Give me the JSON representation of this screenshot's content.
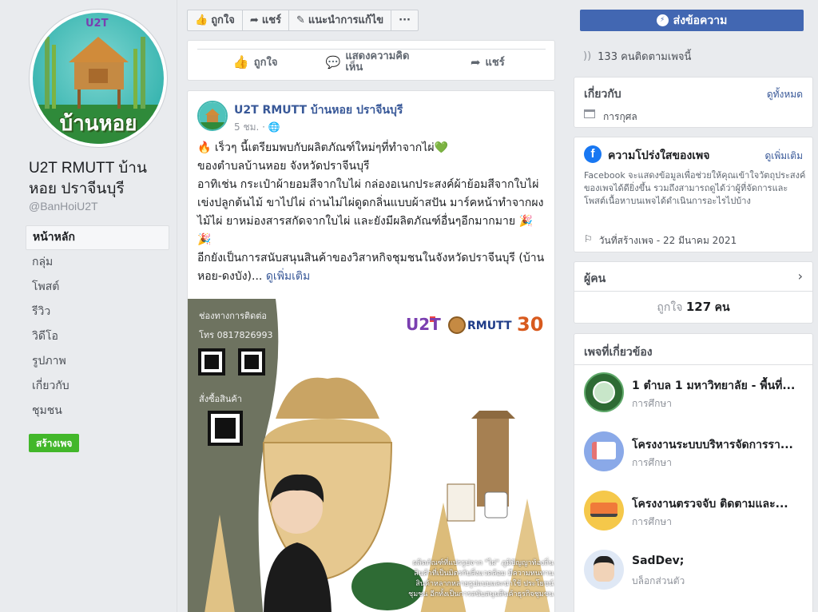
{
  "page": {
    "name": "U2T RMUTT บ้านหอย ปราจีนบุรี",
    "handle": "@BanHoiU2T",
    "avatar_text": "บ้านหอย",
    "avatar_badge": "U2T"
  },
  "nav": {
    "items": [
      {
        "label": "หน้าหลัก",
        "active": true
      },
      {
        "label": "กลุ่ม"
      },
      {
        "label": "โพสต์"
      },
      {
        "label": "รีวิว"
      },
      {
        "label": "วิดีโอ"
      },
      {
        "label": "รูปภาพ"
      },
      {
        "label": "เกี่ยวกับ"
      },
      {
        "label": "ชุมชน"
      }
    ],
    "create_page": "สร้างเพจ"
  },
  "top_actions": {
    "like": "ถูกใจ",
    "share": "แชร์",
    "suggest_edit": "แนะนำการแก้ไข",
    "more": "···",
    "send_message": "ส่งข้อความ"
  },
  "prev_post_actions": {
    "like": "ถูกใจ",
    "comment": "แสดงความคิดเห็น",
    "share": "แชร์"
  },
  "post": {
    "author": "U2T RMUTT บ้านหอย ปราจีนบุรี",
    "time": "5 ชม. ·",
    "lines": [
      "🔥 เร็วๆ นี้เตรียมพบกับผลิตภัณฑ์ใหม่ๆที่ทำจากไผ่💚",
      "ของตำบลบ้านหอย จังหวัดปราจีนบุรี",
      "อาทิเช่น กระเป๋าผ้ายอมสีจากใบไผ่ กล่องอเนกประสงค์ผ้าย้อมสีจากใบไผ่ เข่งปลูกต้นไม้ ขาไปไผ่ ถ่านไม่ไผ่ดูดกลิ่นแบบผ้าสปัน มาร์คหน้าทำจากผงไม้ไผ่ ยาหม่องสารสกัดจากใบไผ่ และยังมีผลิตภัณฑ์อื่นๆอีกมากมาย 🎉",
      "🎉",
      "อีกยังเป็นการสนับสนุนสินค้าของวิสาหกิจชุมชนในจังหวัดปราจีนบุรี (บ้านหอย-ดงบัง)..."
    ],
    "see_more": "ดูเพิ่มเติม",
    "image": {
      "contact_label": "ช่องทางการติดต่อ",
      "phone": "โทร 0817826993",
      "order_label": "สั่งซื้อสินค้า",
      "logo_u2t": "U2T",
      "logo_rmutt": "RMUTT",
      "logo_anniv": "30",
      "caption_lines": [
        "ผลิตภัณฑ์ที่แปรรูปจาก \"ไผ่\" ภูมิปัญญาท้องถิ่น",
        "สินค้าที่เป็นมิตรกับสิ่งแวดล้อม มีความทนทาน",
        "สินค้าหลากหลายรูปแบบและน่าใช้ ประโยชน์",
        "ชุมชน อีกทั้งเป็นการสนับสนุนสินค้าธุรกิจชุมชน"
      ]
    }
  },
  "sidebar": {
    "followers": "133 คนติดตามเพจนี้",
    "about": {
      "title": "เกี่ยวกับ",
      "see_all": "ดูทั้งหมด",
      "category": "การกุศล"
    },
    "transparency": {
      "title": "ความโปร่งใสของเพจ",
      "see_more": "ดูเพิ่มเติม",
      "text": "Facebook จะแสดงข้อมูลเพื่อช่วยให้คุณเข้าใจวัตถุประสงค์ของเพจได้ดียิ่งขึ้น รวมถึงสามารถดูได้ว่าผู้ที่จัดการและโพสต์เนื้อหาบนเพจได้ดำเนินการอะไรไปบ้าง",
      "created": "วันที่สร้างเพจ - 22 มีนาคม 2021"
    },
    "people": {
      "title": "ผู้คน",
      "likes_prefix": "ถูกใจ",
      "likes_count": "127",
      "likes_suffix": "คน"
    },
    "related": {
      "title": "เพจที่เกี่ยวข้อง",
      "items": [
        {
          "name": "1 ตำบล 1 มหาวิทยาลัย - พื้นที่...",
          "category": "การศึกษา"
        },
        {
          "name": "โครงงานระบบบริหารจัดการรา...",
          "category": "การศึกษา"
        },
        {
          "name": "โครงงานตรวจจับ ติดตามและ...",
          "category": "การศึกษา"
        },
        {
          "name": "SadDev;",
          "category": "บล็อกส่วนตัว"
        }
      ]
    }
  }
}
